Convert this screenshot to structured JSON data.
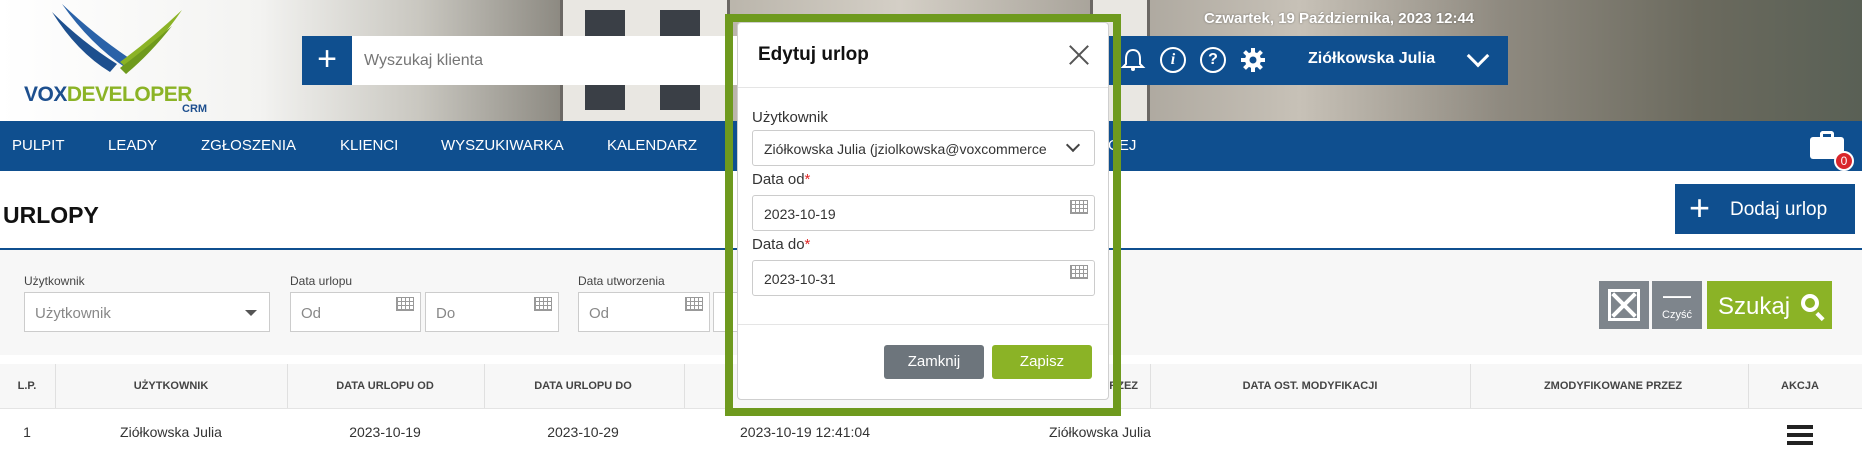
{
  "header": {
    "logo": {
      "word1": "VOX",
      "word2": "DEVELOPER",
      "sub": "CRM"
    },
    "search_placeholder": "Wyszukaj klienta",
    "datetime": "Czwartek, 19 Października, 2023   12:44",
    "username": "Ziółkowska Julia",
    "icons": [
      "bell-icon",
      "info-icon",
      "help-icon",
      "gear-icon",
      "chevron-down-icon"
    ]
  },
  "nav": {
    "items": [
      "PULPIT",
      "LEADY",
      "ZGŁOSZENIA",
      "KLIENCI",
      "WYSZUKIWARKA",
      "KALENDARZ",
      "CEJ"
    ],
    "badge": "0"
  },
  "page": {
    "title": "URLOPY",
    "add_button": "Dodaj urlop"
  },
  "filters": {
    "user_label": "Użytkownik",
    "user_placeholder": "Użytkownik",
    "leave_date_label": "Data urlopu",
    "created_date_label": "Data utworzenia",
    "from_placeholder": "Od",
    "to_placeholder": "Do",
    "clear_label": "Czyść",
    "search_label": "Szukaj"
  },
  "table": {
    "columns": [
      "L.P.",
      "UŻYTKOWNIK",
      "DATA URLOPU OD",
      "DATA URLOPU DO",
      "",
      "PRZEZ",
      "DATA OST. MODYFIKACJI",
      "ZMODYFIKOWANE PRZEZ",
      "AKCJA"
    ],
    "rows": [
      {
        "lp": "1",
        "user": "Ziółkowska Julia",
        "from": "2023-10-19",
        "to": "2023-10-29",
        "created": "2023-10-19 12:41:04",
        "created_by": "Ziółkowska Julia",
        "modified": "",
        "modified_by": ""
      }
    ]
  },
  "modal": {
    "title": "Edytuj urlop",
    "user_label": "Użytkownik",
    "user_value": "Ziółkowska Julia (jziolkowska@voxcommerce",
    "from_label": "Data od",
    "from_value": "2023-10-19",
    "to_label": "Data do",
    "to_value": "2023-10-31",
    "required_mark": "*",
    "cancel_button": "Zamknij",
    "save_button": "Zapisz"
  },
  "colors": {
    "primary": "#0f4f8f",
    "accent": "#8bb326",
    "danger": "#d9262b",
    "modal_highlight": "#6e9a1e"
  }
}
